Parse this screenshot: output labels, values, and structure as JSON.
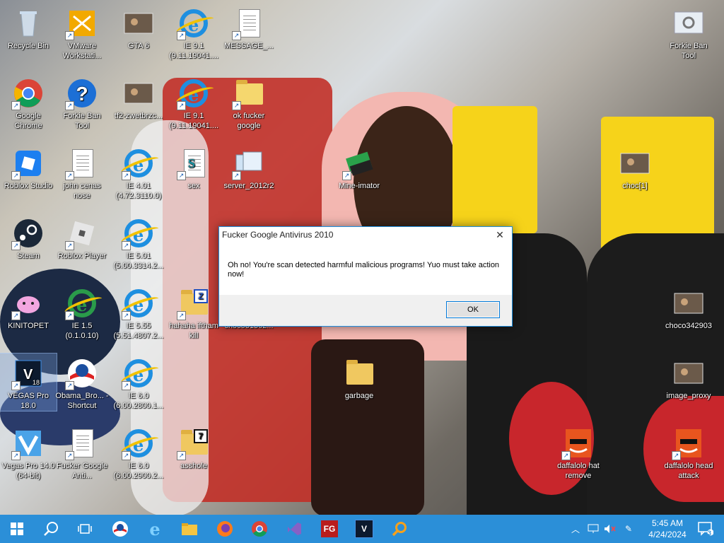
{
  "desktop": {
    "icons": [
      {
        "name": "recycle-bin",
        "label": "Recycle Bin",
        "kind": "recycle"
      },
      {
        "name": "vmware-workstation",
        "label": "VMware Workstati...",
        "kind": "vmware"
      },
      {
        "name": "gta6",
        "label": "GTA 6",
        "kind": "photo"
      },
      {
        "name": "ie-9-1-a",
        "label": "IE 9.1 (9.11.19041....",
        "kind": "ie"
      },
      {
        "name": "message",
        "label": "MESSAGE_...",
        "kind": "doc"
      },
      {
        "name": "forkie-ban-tool-right",
        "label": "Forkie Ban Tool",
        "kind": "gear"
      },
      {
        "name": "google-chrome",
        "label": "Google Chrome",
        "kind": "chrome"
      },
      {
        "name": "forkie-ban-tool",
        "label": "Forkie Ban Tool",
        "kind": "help"
      },
      {
        "name": "tf2-zwetbrzc",
        "label": "tf2-zwetbrzc...",
        "kind": "photo"
      },
      {
        "name": "ie-9-1-b",
        "label": "IE 9.1 (9.11.19041....",
        "kind": "ie"
      },
      {
        "name": "ok-fucker-google",
        "label": "ok fucker google",
        "kind": "zip"
      },
      {
        "name": "roblox-studio",
        "label": "Roblox Studio",
        "kind": "roblox"
      },
      {
        "name": "john-cenas-nose",
        "label": "john cenas nose",
        "kind": "doc"
      },
      {
        "name": "ie-4-01",
        "label": "IE 4.01 (4.72.3110.0)",
        "kind": "ie"
      },
      {
        "name": "sex",
        "label": "sex",
        "kind": "script"
      },
      {
        "name": "server-2012r2",
        "label": "server_2012r2",
        "kind": "server"
      },
      {
        "name": "mine-imator",
        "label": "Mine-imator",
        "kind": "mine"
      },
      {
        "name": "choc1",
        "label": "choc[1]",
        "kind": "photo"
      },
      {
        "name": "steam",
        "label": "Steam",
        "kind": "steam"
      },
      {
        "name": "roblox-player",
        "label": "Roblox Player",
        "kind": "robloxp"
      },
      {
        "name": "ie-5-01",
        "label": "IE 5.01 (5.00.3314.2...",
        "kind": "ie"
      },
      {
        "name": "kinitopet",
        "label": "KINITOPET",
        "kind": "kinito"
      },
      {
        "name": "ie-1-5",
        "label": "IE 1.5 (0.1.0.10)",
        "kind": "ie1"
      },
      {
        "name": "ie-5-55",
        "label": "IE 5.55 (5.51.4807.2...",
        "kind": "ie"
      },
      {
        "name": "hahaha-iftham-kill",
        "label": "hahaha iftham kill",
        "kind": "zipfolder"
      },
      {
        "name": "choco1362",
        "label": "choco31362...",
        "kind": "photo"
      },
      {
        "name": "choco342903",
        "label": "choco342903",
        "kind": "photo"
      },
      {
        "name": "vegas-pro-18",
        "label": "VEGAS Pro 18.0",
        "kind": "vegas18"
      },
      {
        "name": "obama-browser",
        "label": "Obama_Bro... - Shortcut",
        "kind": "obama"
      },
      {
        "name": "ie-6-0-a",
        "label": "IE 6.0 (6.00.2800.1...",
        "kind": "ie"
      },
      {
        "name": "garbage",
        "label": "garbage",
        "kind": "folder"
      },
      {
        "name": "image-proxy",
        "label": "image_proxy",
        "kind": "photo"
      },
      {
        "name": "vegas-pro-14",
        "label": "Vegas Pro 14.0 (64-bit)",
        "kind": "vegas14"
      },
      {
        "name": "fucker-google-anti",
        "label": "Fucker Google Anti...",
        "kind": "blank"
      },
      {
        "name": "ie-6-0-b",
        "label": "IE 6.0 (6.00.2900.2...",
        "kind": "ie"
      },
      {
        "name": "asshole",
        "label": "asshole",
        "kind": "zipfolder7"
      },
      {
        "name": "daffalolo-hat-remove",
        "label": "daffalolo hat remove",
        "kind": "daffa"
      },
      {
        "name": "daffalolo-head-attack",
        "label": "daffalolo head attack",
        "kind": "daffa"
      }
    ]
  },
  "dialog": {
    "title": "Fucker Google Antivirus 2010",
    "close": "✕",
    "message": "Oh no! You're scan detected harmful malicious programs! Yuo must take action now!",
    "ok_label": "OK"
  },
  "taskbar": {
    "color": "#2b8fd8",
    "clock_time": "5:45 AM",
    "clock_date": "4/24/2024",
    "notifications_count": "3"
  }
}
